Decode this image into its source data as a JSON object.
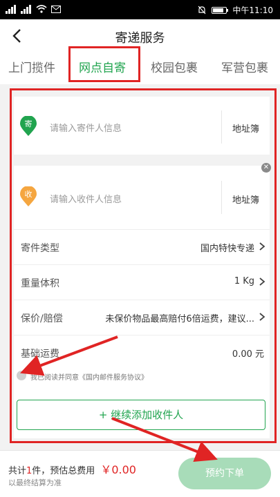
{
  "status_bar": {
    "time": "中午11:10"
  },
  "header": {
    "title": "寄递服务"
  },
  "tabs": [
    {
      "label": "上门揽件",
      "active": false
    },
    {
      "label": "网点自寄",
      "active": true
    },
    {
      "label": "校园包裹",
      "active": false
    },
    {
      "label": "军营包裹",
      "active": false
    }
  ],
  "sender": {
    "badge": "寄",
    "placeholder": "请输入寄件人信息",
    "address_book": "地址簿"
  },
  "receiver": {
    "badge": "收",
    "placeholder": "请输入收件人信息",
    "address_book": "地址簿"
  },
  "rows": [
    {
      "label": "寄件类型",
      "value": "国内特快专递"
    },
    {
      "label": "重量体积",
      "value": "1 Kg"
    },
    {
      "label": "保价/赔偿",
      "value": "未保价物品最高赔付6倍运费，建议..."
    },
    {
      "label": "基础运费",
      "value": "0.00 元"
    }
  ],
  "agreement": {
    "text": "我已阅读并同意《国内邮件服务协议》"
  },
  "add_receiver": {
    "label": "+ 继续添加收件人"
  },
  "footer": {
    "count_prefix": "共计",
    "count": "1",
    "count_suffix": "件，预估总费用",
    "price": "￥0.00",
    "note": "以最终结算为准",
    "submit": "预约下单"
  },
  "colors": {
    "accent": "#21a44f",
    "annotation": "#e02424",
    "receiver_badge": "#f5a640",
    "submit_bg": "#a8dcb9"
  }
}
